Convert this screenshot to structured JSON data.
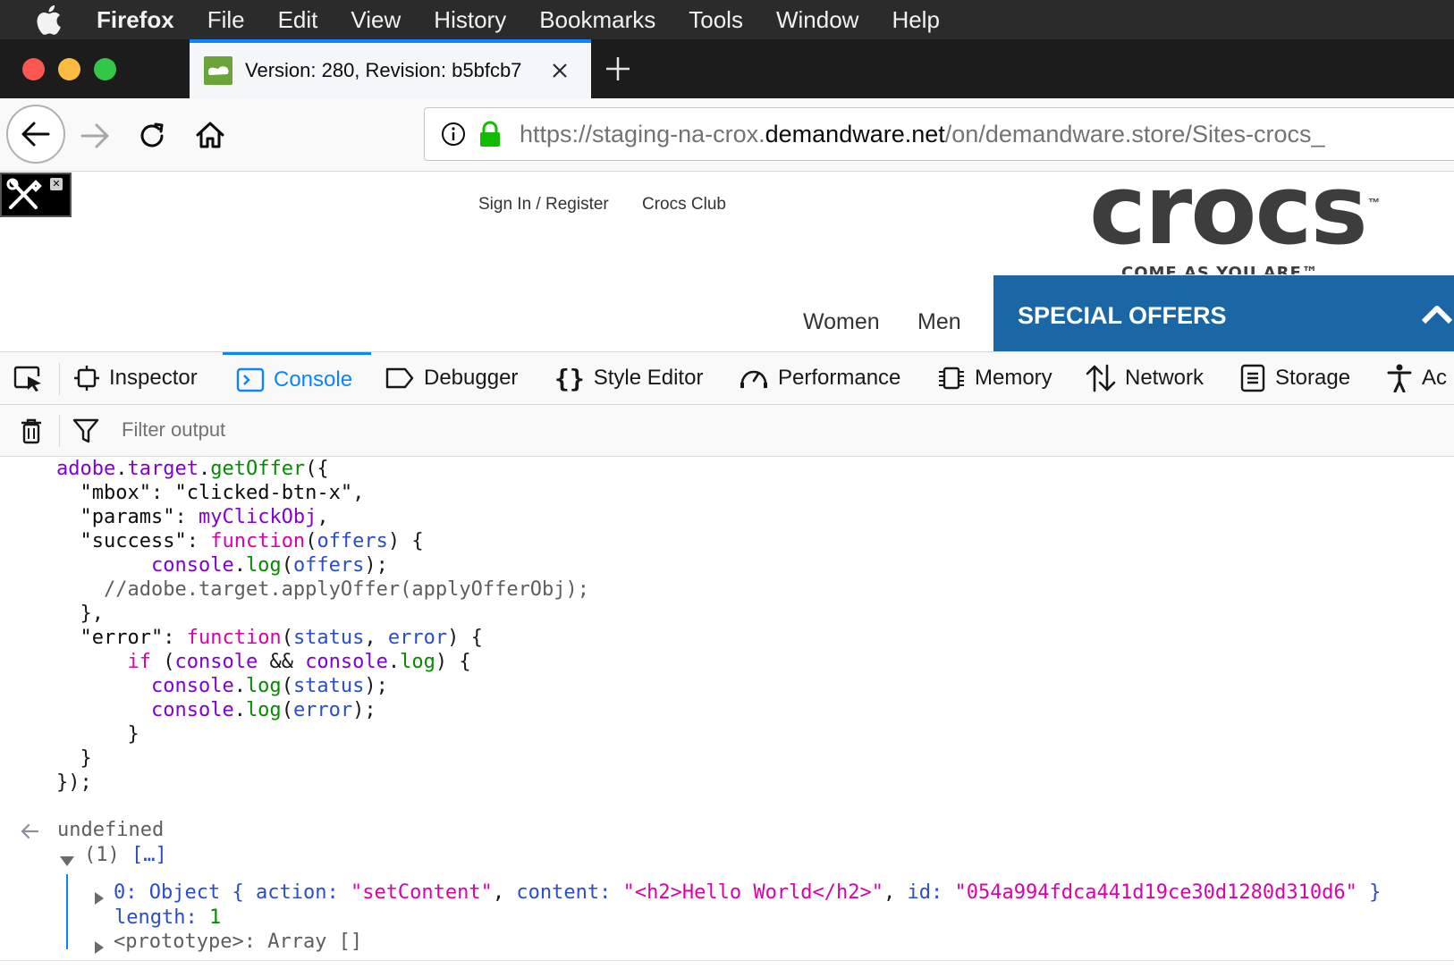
{
  "menubar": {
    "app_name": "Firefox",
    "items": [
      "File",
      "Edit",
      "View",
      "History",
      "Bookmarks",
      "Tools",
      "Window",
      "Help"
    ]
  },
  "tab": {
    "title": "Version: 280, Revision: b5bfcb7",
    "favicon": "crocs-shoe-icon"
  },
  "navbar": {
    "url_prefix": "https://staging-na-crox.",
    "url_domain": "demandware.net",
    "url_suffix": "/on/demandware.store/Sites-crocs_"
  },
  "page": {
    "util_links": [
      "Sign In / Register",
      "Crocs Club"
    ],
    "logo_text": "crocs",
    "logo_tm": "™",
    "logo_tagline": "COME AS YOU ARE™",
    "nav_links": [
      "Women",
      "Men"
    ],
    "special_offers": "SPECIAL OFFERS",
    "brand_color": "#1b66a4"
  },
  "devtools": {
    "tabs": [
      "Inspector",
      "Console",
      "Debugger",
      "Style Editor",
      "Performance",
      "Memory",
      "Network",
      "Storage",
      "Ac"
    ],
    "active_tab": "Console",
    "filter_placeholder": "Filter output"
  },
  "console": {
    "code": [
      {
        "indent": "",
        "tokens": [
          [
            "adobe",
            "purple"
          ],
          [
            ".",
            "default"
          ],
          [
            "target",
            "purple"
          ],
          [
            ".",
            "default"
          ],
          [
            "getOffer",
            "green"
          ],
          [
            "({",
            "default"
          ]
        ]
      },
      {
        "indent": "  ",
        "tokens": [
          [
            "\"mbox\"",
            "dark"
          ],
          [
            ": ",
            "default"
          ],
          [
            "\"clicked-btn-x\"",
            "dark"
          ],
          [
            ",",
            "default"
          ]
        ]
      },
      {
        "indent": "  ",
        "tokens": [
          [
            "\"params\"",
            "dark"
          ],
          [
            ": ",
            "default"
          ],
          [
            "myClickObj",
            "purple"
          ],
          [
            ",",
            "default"
          ]
        ]
      },
      {
        "indent": "  ",
        "tokens": [
          [
            "\"success\"",
            "dark"
          ],
          [
            ": ",
            "default"
          ],
          [
            "function",
            "magenta"
          ],
          [
            "(",
            "default"
          ],
          [
            "offers",
            "blue"
          ],
          [
            ") {",
            "default"
          ]
        ]
      },
      {
        "indent": "        ",
        "tokens": [
          [
            "console",
            "purple"
          ],
          [
            ".",
            "default"
          ],
          [
            "log",
            "green"
          ],
          [
            "(",
            "default"
          ],
          [
            "offers",
            "blue"
          ],
          [
            ");",
            "default"
          ]
        ]
      },
      {
        "indent": "    ",
        "tokens": [
          [
            "//adobe.target.applyOffer(applyOfferObj);",
            "gray"
          ]
        ]
      },
      {
        "indent": "  ",
        "tokens": [
          [
            "},",
            "default"
          ]
        ]
      },
      {
        "indent": "  ",
        "tokens": [
          [
            "\"error\"",
            "dark"
          ],
          [
            ": ",
            "default"
          ],
          [
            "function",
            "magenta"
          ],
          [
            "(",
            "default"
          ],
          [
            "status",
            "blue"
          ],
          [
            ", ",
            "default"
          ],
          [
            "error",
            "blue"
          ],
          [
            ") {",
            "default"
          ]
        ]
      },
      {
        "indent": "      ",
        "tokens": [
          [
            "if",
            "magenta"
          ],
          [
            " (",
            "default"
          ],
          [
            "console",
            "purple"
          ],
          [
            " && ",
            "default"
          ],
          [
            "console",
            "purple"
          ],
          [
            ".",
            "default"
          ],
          [
            "log",
            "green"
          ],
          [
            ") {",
            "default"
          ]
        ]
      },
      {
        "indent": "        ",
        "tokens": [
          [
            "console",
            "purple"
          ],
          [
            ".",
            "default"
          ],
          [
            "log",
            "green"
          ],
          [
            "(",
            "default"
          ],
          [
            "status",
            "blue"
          ],
          [
            ");",
            "default"
          ]
        ]
      },
      {
        "indent": "        ",
        "tokens": [
          [
            "console",
            "purple"
          ],
          [
            ".",
            "default"
          ],
          [
            "log",
            "green"
          ],
          [
            "(",
            "default"
          ],
          [
            "error",
            "blue"
          ],
          [
            ");",
            "default"
          ]
        ]
      },
      {
        "indent": "      ",
        "tokens": [
          [
            "}",
            "default"
          ]
        ]
      },
      {
        "indent": "  ",
        "tokens": [
          [
            "}",
            "default"
          ]
        ]
      },
      {
        "indent": "",
        "tokens": [
          [
            "});",
            "default"
          ]
        ]
      }
    ],
    "result": "undefined",
    "array_header_count": "(1)",
    "array_header_preview": "[…]",
    "item_index": "0:",
    "item_type": "Object",
    "item_open": "{",
    "item_key1": "action:",
    "item_val1": "\"setContent\"",
    "item_key2": "content:",
    "item_val2": "\"<h2>Hello World</h2>\"",
    "item_key3": "id:",
    "item_val3": "\"054a994fdca441d19ce30d1280d310d6\"",
    "item_close": "}",
    "length_key": "length:",
    "length_value": "1",
    "proto_key": "<prototype>:",
    "proto_value": "Array []"
  }
}
